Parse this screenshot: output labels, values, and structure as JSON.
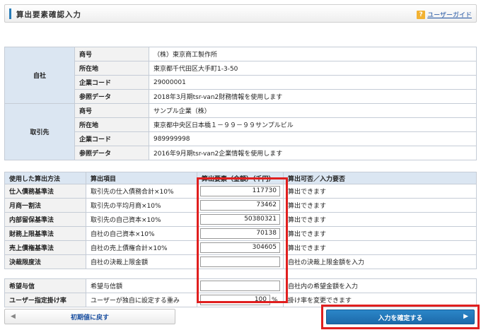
{
  "header": {
    "title": "算出要素確認入力",
    "guide_icon": "?",
    "guide_label": "ユーザーガイド"
  },
  "self": {
    "group": "自社",
    "rows": [
      {
        "label": "商号",
        "value": "（株）東京商工製作所"
      },
      {
        "label": "所在地",
        "value": "東京都千代田区大手町1-3-50"
      },
      {
        "label": "企業コード",
        "value": "29000001"
      },
      {
        "label": "参照データ",
        "value": "2018年3月期tsr-van2財務情報を使用します"
      }
    ]
  },
  "partner": {
    "group": "取引先",
    "rows": [
      {
        "label": "商号",
        "value": "サンプル企業（株）"
      },
      {
        "label": "所在地",
        "value": "東京都中央区日本橋１－９９－９９サンプルビル"
      },
      {
        "label": "企業コード",
        "value": "989999998"
      },
      {
        "label": "参照データ",
        "value": "2016年9月期tsr-van2企業情報を使用します"
      }
    ]
  },
  "calc": {
    "headers": {
      "method": "使用した算出方法",
      "item": "算出項目",
      "value": "算出要素（金額）（千円）",
      "result": "算出可否／入力要否"
    },
    "rows": [
      {
        "method": "仕入債務基準法",
        "item": "取引先の仕入債務合計×10%",
        "value": "117730",
        "result": "算出できます"
      },
      {
        "method": "月商一割法",
        "item": "取引先の平均月商×10%",
        "value": "73462",
        "result": "算出できます"
      },
      {
        "method": "内部留保基準法",
        "item": "取引先の自己資本×10%",
        "value": "50380321",
        "result": "算出できます"
      },
      {
        "method": "財務上限基準法",
        "item": "自社の自己資本×10%",
        "value": "70138",
        "result": "算出できます"
      },
      {
        "method": "売上債権基準法",
        "item": "自社の売上債権合計×10%",
        "value": "304605",
        "result": "算出できます"
      },
      {
        "method": "決裁限度法",
        "item": "自社の決裁上限金額",
        "value": "",
        "result": "自社の決裁上限金額を入力"
      }
    ],
    "extra_rows": [
      {
        "method": "希望与信",
        "item": "希望与信額",
        "value": "",
        "result": "自社内の希望金額を入力"
      },
      {
        "method": "ユーザー指定掛け率",
        "item": "ユーザーが独自に設定する重み",
        "value": "100",
        "unit": "%",
        "result": "掛け率を変更できます"
      }
    ]
  },
  "buttons": {
    "reset_label": "初期値に戻す",
    "confirm_label": "入力を確定する",
    "left_arrow": "◀",
    "right_arrow": "▶"
  },
  "colors": {
    "accent": "#2a7db8",
    "header_bg": "#dbe6f2",
    "highlight": "#e01f1f",
    "confirm_bg": "#1d6aaa"
  }
}
